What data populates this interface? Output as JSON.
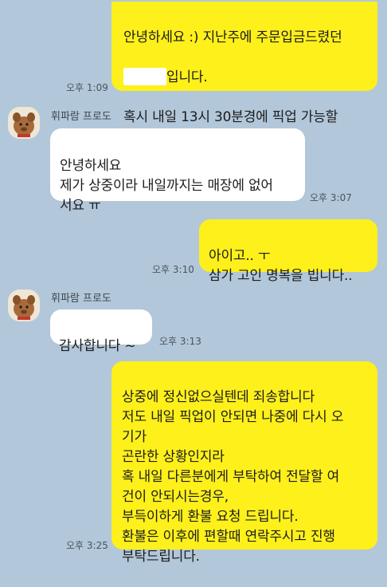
{
  "messages": [
    {
      "sender_side": "me",
      "line1": "안녕하세요 :) 지난주에 주문입금드렸던",
      "line2_suffix": "입니다.",
      "line3": "혹시 내일 13시 30분경에 픽업 가능할\n까요?",
      "time": "오후 1:09"
    },
    {
      "sender_side": "them",
      "sender_name": "휘파람 프로도",
      "text": "안녕하세요\n제가 상중이라 내일까지는 매장에 없어\n서요 ㅠ",
      "time": "오후 3:07"
    },
    {
      "sender_side": "me",
      "text": "아이고.. ㅜ\n삼가 고인 명복을 빕니다..",
      "time": "오후 3:10"
    },
    {
      "sender_side": "them",
      "sender_name": "휘파람 프로도",
      "text": "감사합니다 ~",
      "time": "오후 3:13"
    },
    {
      "sender_side": "me",
      "text": "상중에 정신없으실텐데 죄송합니다\n저도 내일 픽업이 안되면 나중에 다시 오\n기가\n곤란한 상황인지라\n혹 내일 다른분에게 부탁하여 전달할 여\n건이 안되시는경우,\n부득이하게 환불 요청 드립니다.\n환불은 이후에 편할때 연락주시고 진행\n부탁드립니다.",
      "time": "오후 3:25"
    }
  ],
  "colors": {
    "background": "#b2c7d9",
    "my_bubble": "#fef01b",
    "their_bubble": "#ffffff"
  },
  "icons": {
    "avatar": "bear-character-avatar"
  }
}
